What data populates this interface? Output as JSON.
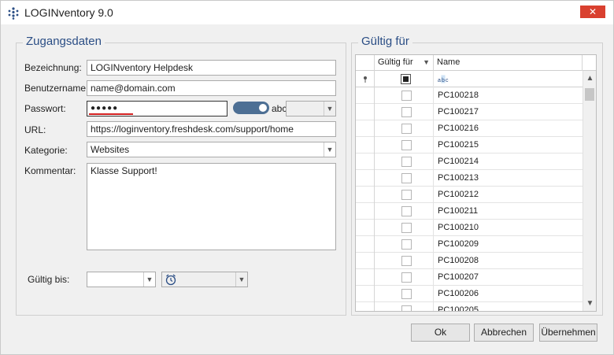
{
  "window": {
    "title": "LOGINventory 9.0",
    "close_glyph": "✕"
  },
  "access": {
    "legend": "Zugangsdaten",
    "name_label": "Bezeichnung:",
    "name_value": "LOGINventory Helpdesk",
    "user_label": "Benutzername:",
    "user_value": "name@domain.com",
    "password_label": "Passwort:",
    "password_value": "●●●●●",
    "show_password_label": "abc",
    "url_label": "URL:",
    "url_value": "https://loginventory.freshdesk.com/support/home",
    "category_label": "Kategorie:",
    "category_value": "Websites",
    "comment_label": "Kommentar:",
    "comment_value": "Klasse Support!",
    "valid_until_label": "Gültig bis:",
    "valid_until_date": "",
    "valid_until_time": ""
  },
  "valid_for": {
    "legend": "Gültig für",
    "columns": [
      "Gültig für",
      "Name"
    ],
    "filter_name_icon": "abc-filter-icon",
    "rows": [
      {
        "checked": false,
        "name": "PC100218"
      },
      {
        "checked": false,
        "name": "PC100217"
      },
      {
        "checked": false,
        "name": "PC100216"
      },
      {
        "checked": false,
        "name": "PC100215"
      },
      {
        "checked": false,
        "name": "PC100214"
      },
      {
        "checked": false,
        "name": "PC100213"
      },
      {
        "checked": false,
        "name": "PC100212"
      },
      {
        "checked": false,
        "name": "PC100211"
      },
      {
        "checked": false,
        "name": "PC100210"
      },
      {
        "checked": false,
        "name": "PC100209"
      },
      {
        "checked": false,
        "name": "PC100208"
      },
      {
        "checked": false,
        "name": "PC100207"
      },
      {
        "checked": false,
        "name": "PC100206"
      },
      {
        "checked": false,
        "name": "PC100205"
      }
    ]
  },
  "buttons": {
    "ok": "Ok",
    "cancel": "Abbrechen",
    "apply": "Übernehmen"
  },
  "colors": {
    "accent": "#2b4e85",
    "close_red": "#d9402f",
    "toggle": "#4d6f94",
    "password_underline": "#d32020"
  }
}
